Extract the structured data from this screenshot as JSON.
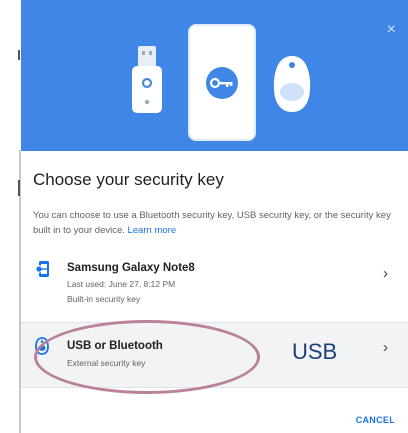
{
  "dialog": {
    "close_glyph": "×",
    "title": "Choose your security key",
    "description": "You can choose to use a Bluetooth security key, USB security key, or the security key built in to your device.",
    "learn_more": "Learn more",
    "cancel_label": "CANCEL"
  },
  "options": [
    {
      "title": "Samsung Galaxy Note8",
      "subtitle_1": "Last used: June 27, 8:12 PM",
      "subtitle_2": "Built-in security key",
      "icon": "phone-key-icon"
    },
    {
      "title": "USB or Bluetooth",
      "subtitle_1": "External security key",
      "icon": "security-key-icon"
    }
  ],
  "chevron_glyph": "›",
  "annotation": {
    "usb_label": "USB"
  },
  "colors": {
    "banner": "#3f86e6",
    "link": "#1a73e8",
    "highlight_circle": "#b9829a",
    "annotation_text": "#1f3f7a"
  }
}
